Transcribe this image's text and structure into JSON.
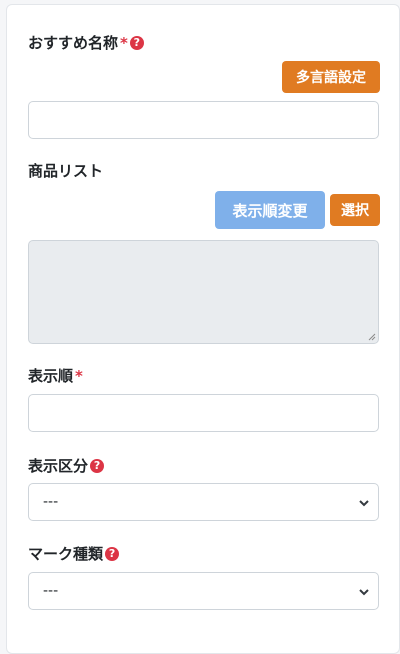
{
  "form": {
    "recommend_name": {
      "label": "おすすめ名称",
      "required_mark": "*",
      "help_glyph": "?",
      "multilang_button": "多言語設定",
      "value": ""
    },
    "product_list": {
      "label": "商品リスト",
      "reorder_button": "表示順変更",
      "select_button": "選択",
      "value": ""
    },
    "display_order": {
      "label": "表示順",
      "required_mark": "*",
      "value": ""
    },
    "display_category": {
      "label": "表示区分",
      "help_glyph": "?",
      "selected": "---"
    },
    "mark_type": {
      "label": "マーク種類",
      "help_glyph": "?",
      "selected": "---"
    }
  },
  "colors": {
    "accent_orange": "#e07b22",
    "accent_blue_light": "#7fb0ea",
    "required_red": "#dc3545",
    "readonly_gray": "#e9ecef"
  }
}
